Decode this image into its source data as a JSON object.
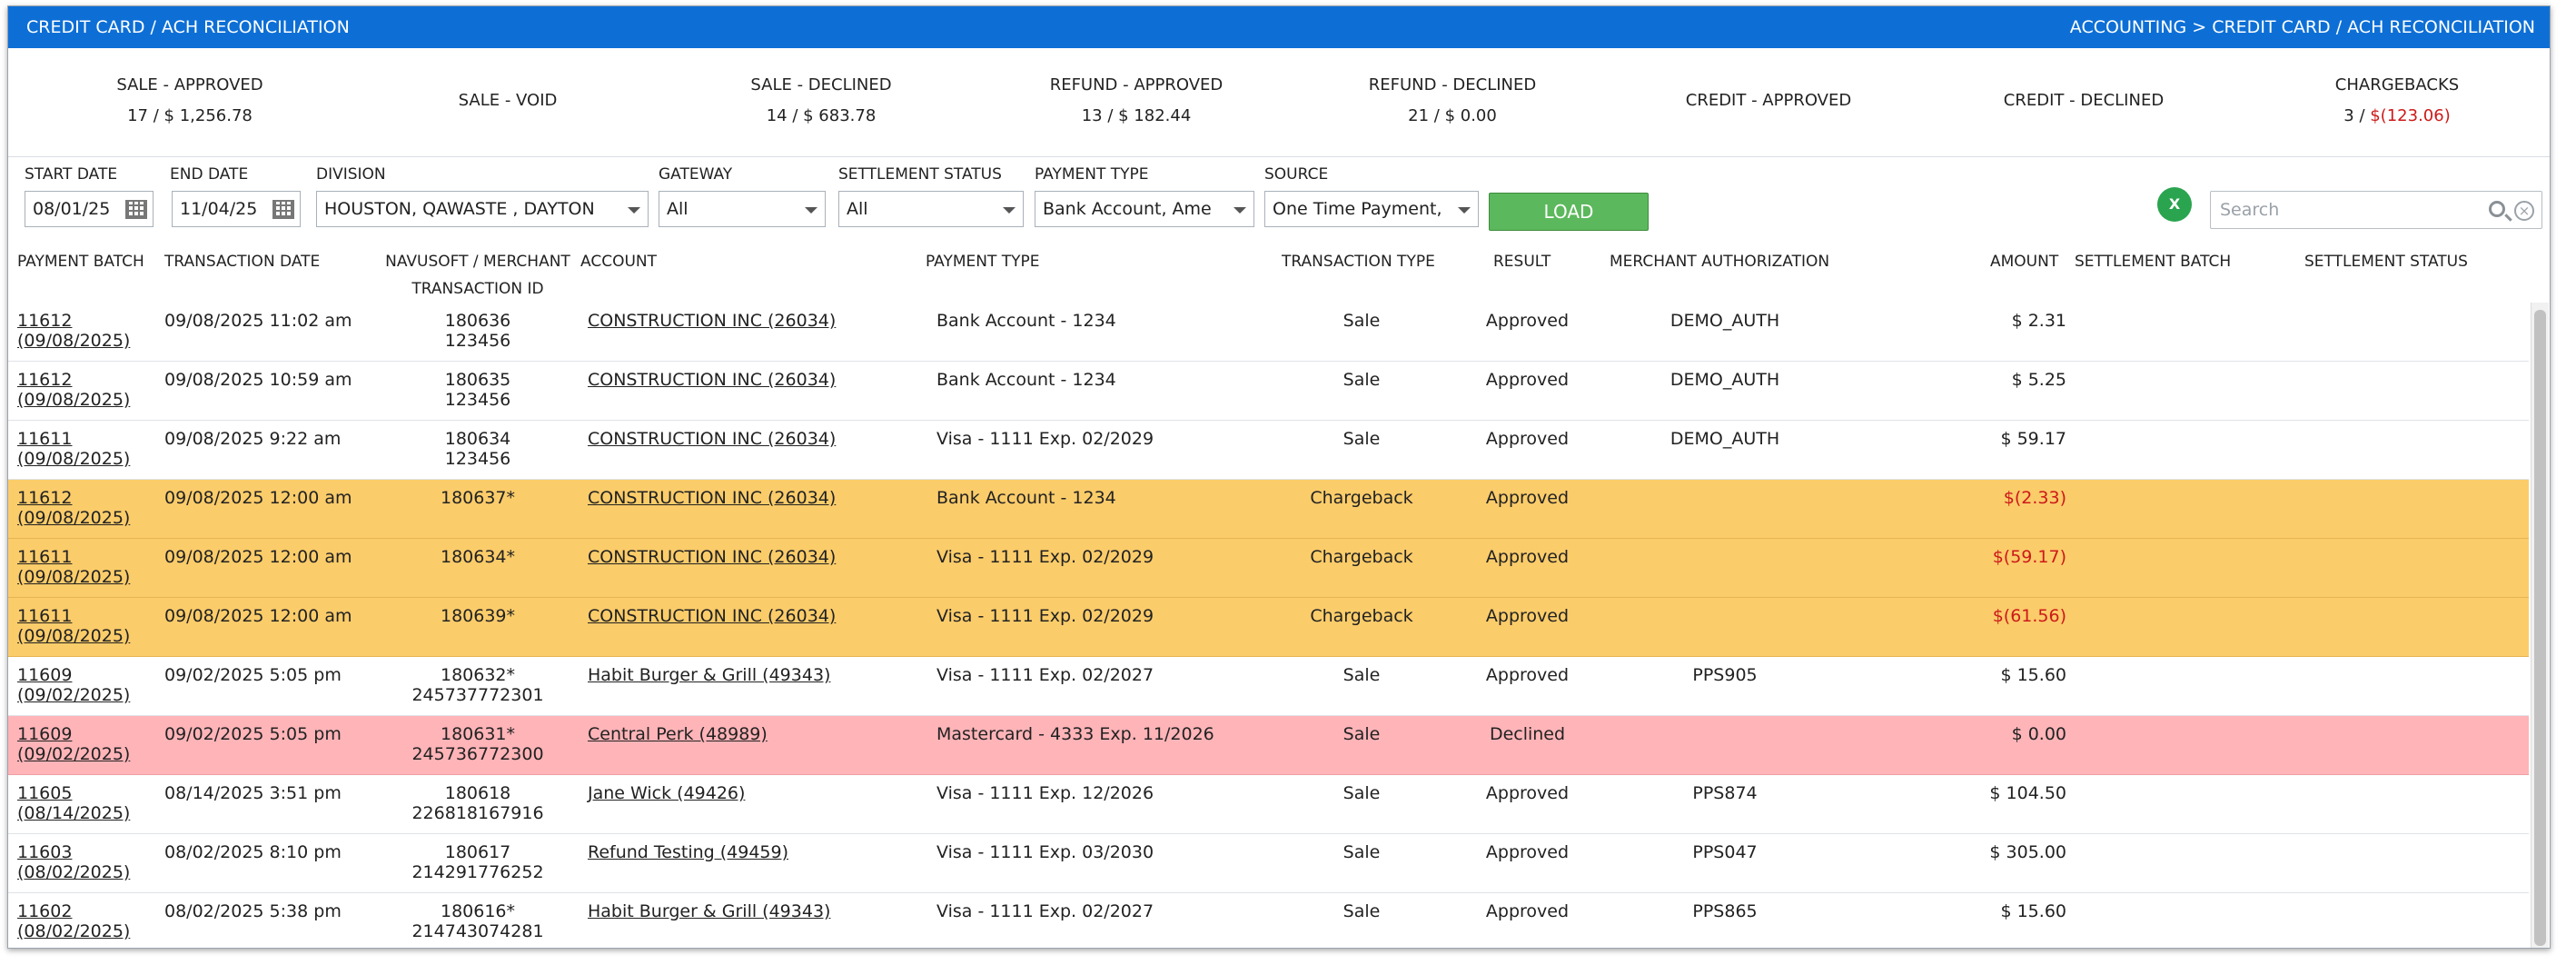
{
  "header": {
    "title": "CREDIT CARD / ACH RECONCILIATION",
    "breadcrumb": "ACCOUNTING > CREDIT CARD / ACH RECONCILIATION"
  },
  "summary": [
    {
      "label": "SALE - APPROVED",
      "count": "17 / ",
      "amount": "$ 1,256.78"
    },
    {
      "label": "SALE - VOID",
      "count": "",
      "amount": ""
    },
    {
      "label": "SALE - DECLINED",
      "count": "14 / ",
      "amount": "$ 683.78"
    },
    {
      "label": "REFUND - APPROVED",
      "count": "13 / ",
      "amount": "$ 182.44"
    },
    {
      "label": "REFUND - DECLINED",
      "count": "21 / ",
      "amount": "$ 0.00"
    },
    {
      "label": "CREDIT - APPROVED",
      "count": "",
      "amount": ""
    },
    {
      "label": "CREDIT - DECLINED",
      "count": "",
      "amount": ""
    },
    {
      "label": "CHARGEBACKS",
      "count": "3 / ",
      "amount": "$(123.06)"
    }
  ],
  "filters": {
    "start_date": {
      "label": "START DATE",
      "value": "08/01/25"
    },
    "end_date": {
      "label": "END DATE",
      "value": "11/04/25"
    },
    "division": {
      "label": "DIVISION",
      "value": "HOUSTON, QAWASTE , DAYTON"
    },
    "gateway": {
      "label": "GATEWAY",
      "value": "All"
    },
    "settlement_status": {
      "label": "SETTLEMENT STATUS",
      "value": "All"
    },
    "payment_type": {
      "label": "PAYMENT TYPE",
      "value": "Bank Account, Ame"
    },
    "source": {
      "label": "SOURCE",
      "value": "One Time Payment,"
    },
    "load_label": "LOAD",
    "excel_label": "X",
    "search_placeholder": "Search"
  },
  "table": {
    "columns": {
      "batch": "PAYMENT BATCH",
      "tdate": "TRANSACTION DATE",
      "txid_1": "NAVUSOFT / MERCHANT",
      "txid_2": "TRANSACTION ID",
      "account": "ACCOUNT",
      "ptype": "PAYMENT TYPE",
      "ttype": "TRANSACTION TYPE",
      "result": "RESULT",
      "auth": "MERCHANT AUTHORIZATION",
      "amount": "AMOUNT",
      "sbatch": "SETTLEMENT BATCH",
      "sstatus": "SETTLEMENT STATUS"
    },
    "rows": [
      {
        "style": "normal",
        "batch": "11612",
        "batch_date": "(09/08/2025)",
        "tdate": "09/08/2025 11:02 am",
        "tx1": "180636",
        "tx2": "123456",
        "account": "CONSTRUCTION INC (26034)",
        "ptype": "Bank Account - 1234",
        "ttype": "Sale",
        "result": "Approved",
        "auth": "DEMO_AUTH",
        "amount": "$ 2.31",
        "neg": false
      },
      {
        "style": "normal",
        "batch": "11612",
        "batch_date": "(09/08/2025)",
        "tdate": "09/08/2025 10:59 am",
        "tx1": "180635",
        "tx2": "123456",
        "account": "CONSTRUCTION INC (26034)",
        "ptype": "Bank Account - 1234",
        "ttype": "Sale",
        "result": "Approved",
        "auth": "DEMO_AUTH",
        "amount": "$ 5.25",
        "neg": false
      },
      {
        "style": "normal",
        "batch": "11611",
        "batch_date": "(09/08/2025)",
        "tdate": "09/08/2025 9:22 am",
        "tx1": "180634",
        "tx2": "123456",
        "account": "CONSTRUCTION INC (26034)",
        "ptype": "Visa - 1111 Exp. 02/2029",
        "ttype": "Sale",
        "result": "Approved",
        "auth": "DEMO_AUTH",
        "amount": "$ 59.17",
        "neg": false
      },
      {
        "style": "chargeback",
        "batch": "11612",
        "batch_date": "(09/08/2025)",
        "tdate": "09/08/2025 12:00 am",
        "tx1": "180637*",
        "tx2": "",
        "account": "CONSTRUCTION INC (26034)",
        "ptype": "Bank Account - 1234",
        "ttype": "Chargeback",
        "result": "Approved",
        "auth": "",
        "amount": "$(2.33)",
        "neg": true
      },
      {
        "style": "chargeback",
        "batch": "11611",
        "batch_date": "(09/08/2025)",
        "tdate": "09/08/2025 12:00 am",
        "tx1": "180634*",
        "tx2": "",
        "account": "CONSTRUCTION INC (26034)",
        "ptype": "Visa - 1111 Exp. 02/2029",
        "ttype": "Chargeback",
        "result": "Approved",
        "auth": "",
        "amount": "$(59.17)",
        "neg": true
      },
      {
        "style": "chargeback",
        "batch": "11611",
        "batch_date": "(09/08/2025)",
        "tdate": "09/08/2025 12:00 am",
        "tx1": "180639*",
        "tx2": "",
        "account": "CONSTRUCTION INC (26034)",
        "ptype": "Visa - 1111 Exp. 02/2029",
        "ttype": "Chargeback",
        "result": "Approved",
        "auth": "",
        "amount": "$(61.56)",
        "neg": true
      },
      {
        "style": "normal",
        "batch": "11609",
        "batch_date": "(09/02/2025)",
        "tdate": "09/02/2025 5:05 pm",
        "tx1": "180632*",
        "tx2": "245737772301",
        "account": "Habit Burger & Grill (49343)",
        "ptype": "Visa - 1111 Exp. 02/2027",
        "ttype": "Sale",
        "result": "Approved",
        "auth": "PPS905",
        "amount": "$ 15.60",
        "neg": false
      },
      {
        "style": "declined",
        "batch": "11609",
        "batch_date": "(09/02/2025)",
        "tdate": "09/02/2025 5:05 pm",
        "tx1": "180631*",
        "tx2": "245736772300",
        "account": "Central Perk (48989)",
        "ptype": "Mastercard - 4333 Exp. 11/2026",
        "ttype": "Sale",
        "result": "Declined",
        "auth": "",
        "amount": "$ 0.00",
        "neg": false
      },
      {
        "style": "normal",
        "batch": "11605",
        "batch_date": "(08/14/2025)",
        "tdate": "08/14/2025 3:51 pm",
        "tx1": "180618",
        "tx2": "226818167916",
        "account": "Jane Wick (49426)",
        "ptype": "Visa - 1111 Exp. 12/2026",
        "ttype": "Sale",
        "result": "Approved",
        "auth": "PPS874",
        "amount": "$ 104.50",
        "neg": false
      },
      {
        "style": "normal",
        "batch": "11603",
        "batch_date": "(08/02/2025)",
        "tdate": "08/02/2025 8:10 pm",
        "tx1": "180617",
        "tx2": "214291776252",
        "account": "Refund Testing (49459)",
        "ptype": "Visa - 1111 Exp. 03/2030",
        "ttype": "Sale",
        "result": "Approved",
        "auth": "PPS047",
        "amount": "$ 305.00",
        "neg": false
      },
      {
        "style": "normal",
        "batch": "11602",
        "batch_date": "(08/02/2025)",
        "tdate": "08/02/2025 5:38 pm",
        "tx1": "180616*",
        "tx2": "214743074281",
        "account": "Habit Burger & Grill (49343)",
        "ptype": "Visa - 1111 Exp. 02/2027",
        "ttype": "Sale",
        "result": "Approved",
        "auth": "PPS865",
        "amount": "$ 15.60",
        "neg": false
      }
    ]
  },
  "colors": {
    "header_blue": "#0d6fd6",
    "chargeback_row": "#fbcc6a",
    "declined_row": "#ffb4b8",
    "negative_text": "#cc1a1a",
    "load_button": "#5cb85c"
  }
}
